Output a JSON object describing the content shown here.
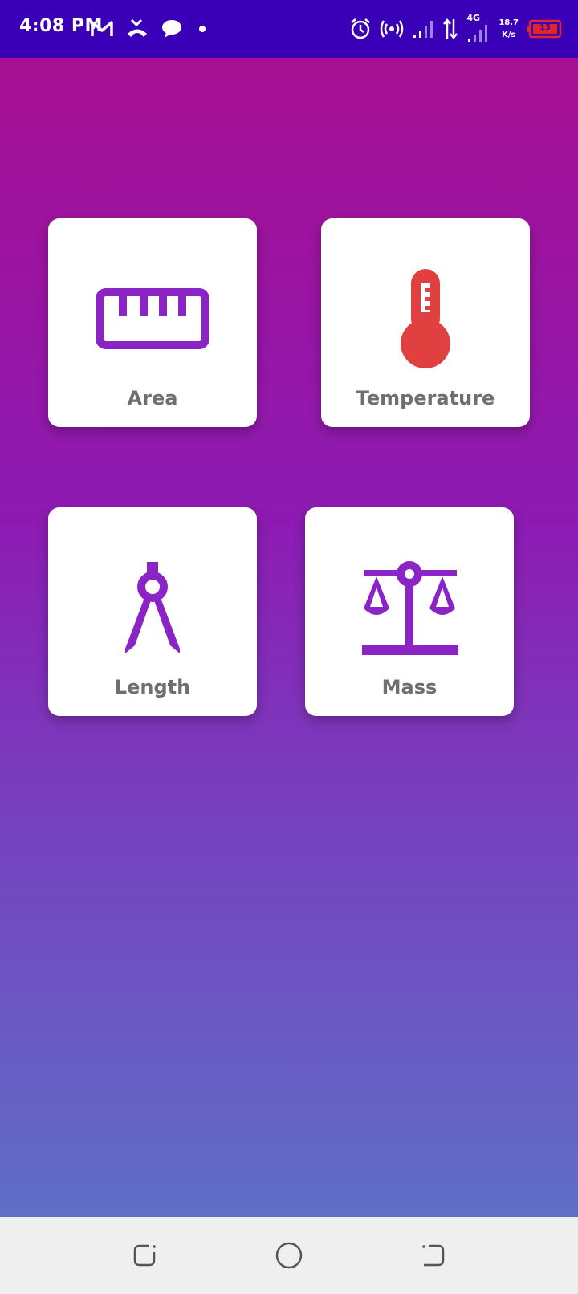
{
  "status_bar": {
    "time": "4:08 PM",
    "network_type": "4G",
    "speed_value": "18.7",
    "speed_unit": "K/s",
    "battery_level": "13",
    "colors": {
      "background": "#3a00b8",
      "battery": "#e0262b"
    },
    "left_icons": [
      "gmail-icon",
      "missed-call-icon",
      "chat-bubble-icon",
      "notification-dot-icon"
    ],
    "right_icons": [
      "alarm-icon",
      "hotspot-icon",
      "signal-bars-icon",
      "data-arrows-icon",
      "signal-bars-4g-icon",
      "battery-icon"
    ]
  },
  "categories": [
    {
      "label": "Area",
      "icon": "ruler-icon",
      "icon_color": "#8b24c4"
    },
    {
      "label": "Temperature",
      "icon": "thermometer-icon",
      "icon_color": "#e04040"
    },
    {
      "label": "Length",
      "icon": "compass-icon",
      "icon_color": "#8b24c4"
    },
    {
      "label": "Mass",
      "icon": "scale-balance-icon",
      "icon_color": "#8b24c4"
    }
  ],
  "nav_bar": {
    "buttons": [
      "recent-apps-button",
      "home-button",
      "back-button"
    ]
  }
}
